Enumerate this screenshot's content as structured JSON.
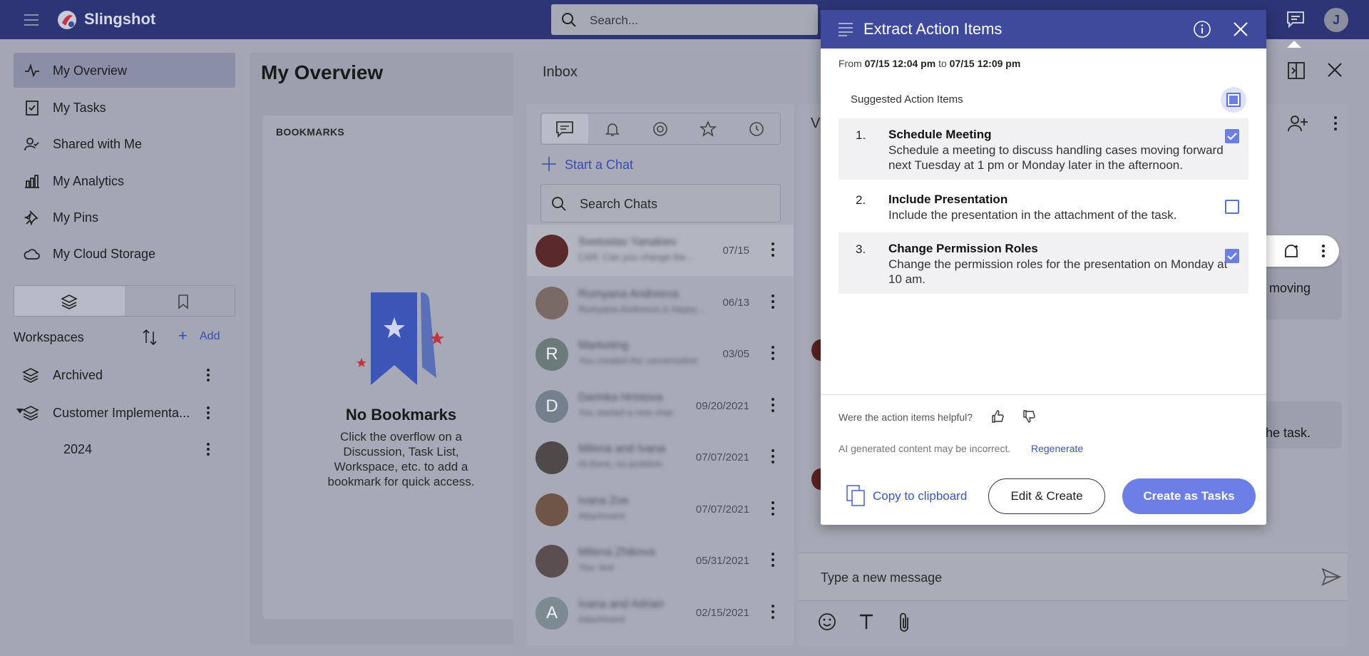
{
  "app": {
    "brand": "Slingshot",
    "user_initial": "J"
  },
  "search": {
    "placeholder": "Search..."
  },
  "nav": {
    "items": [
      {
        "label": "My Overview",
        "icon": "activity-icon"
      },
      {
        "label": "My Tasks",
        "icon": "task-icon"
      },
      {
        "label": "Shared with Me",
        "icon": "user-check-icon"
      },
      {
        "label": "My Analytics",
        "icon": "bar-chart-icon"
      },
      {
        "label": "My Pins",
        "icon": "pin-icon"
      },
      {
        "label": "My Cloud Storage",
        "icon": "cloud-icon"
      }
    ]
  },
  "workspaces": {
    "title": "Workspaces",
    "add_label": "Add",
    "items": [
      {
        "label": "Archived"
      },
      {
        "label": "Customer Implementa..."
      },
      {
        "label": "2024"
      }
    ]
  },
  "main": {
    "title": "My Overview",
    "bookmarks": {
      "header": "BOOKMARKS",
      "empty_title": "No Bookmarks",
      "empty_desc": "Click the overflow on a Discussion, Task List, Workspace, etc. to add a bookmark for quick access."
    }
  },
  "inbox": {
    "title": "Inbox",
    "start_chat": "Start a Chat",
    "search_placeholder": "Search Chats",
    "chats": [
      {
        "name": "Svetoslav Yanakiev",
        "preview": "CAR: Can you change the...",
        "date": "07/15",
        "initial": "",
        "color": "#5a2a2a"
      },
      {
        "name": "Rumyana Andreeva",
        "preview": "Rumyana Andreeva is happy...",
        "date": "06/13",
        "initial": "",
        "color": "#7a6a66"
      },
      {
        "name": "Marketing",
        "preview": "You created the conversation",
        "date": "03/05",
        "initial": "R",
        "color": "#6d7a7a"
      },
      {
        "name": "Darinka Hristova",
        "preview": "You started a new chat",
        "date": "09/20/2021",
        "initial": "D",
        "color": "#74808e"
      },
      {
        "name": "Milena and Ivana",
        "preview": "Hi there, no problem",
        "date": "07/07/2021",
        "initial": "",
        "color": "#4e4a4a"
      },
      {
        "name": "Ivana Zoe",
        "preview": "Attachment",
        "date": "07/07/2021",
        "initial": "",
        "color": "#6e5548"
      },
      {
        "name": "Milena Zhikova",
        "preview": "You: test",
        "date": "05/31/2021",
        "initial": "",
        "color": "#5a4e50"
      },
      {
        "name": "Ivana and Adrian",
        "preview": "Attachment",
        "date": "02/15/2021",
        "initial": "A",
        "color": "#7c8a92"
      }
    ],
    "conversation": {
      "title_initial": "V",
      "bubble1": "s moving",
      "bubble2": "of the task.",
      "input_placeholder": "Type a new message"
    }
  },
  "modal": {
    "title": "Extract Action Items",
    "range_from_label": "From",
    "range_from": "07/15 12:04 pm",
    "range_to_label": "to",
    "range_to": "07/15 12:09 pm",
    "suggested_label": "Suggested Action Items",
    "items": [
      {
        "num": "1.",
        "title": "Schedule Meeting",
        "desc": "Schedule a meeting to discuss handling cases moving forward next Tuesday at 1 pm or Monday later in the afternoon.",
        "checked": true
      },
      {
        "num": "2.",
        "title": "Include Presentation",
        "desc": "Include the presentation in the attachment of the task.",
        "checked": false
      },
      {
        "num": "3.",
        "title": "Change Permission Roles",
        "desc": "Change the permission roles for the presentation on Monday at 10 am.",
        "checked": true
      }
    ],
    "helpful_label": "Were the action items helpful?",
    "disclaimer": "AI generated content may be incorrect.",
    "regenerate": "Regenerate",
    "copy_label": "Copy to clipboard",
    "edit_label": "Edit & Create",
    "create_label": "Create as Tasks"
  },
  "colors": {
    "topbar": "#2d3577",
    "modal_header": "#3e4a9c",
    "accent": "#6b7fe6",
    "link": "#3a55c8"
  }
}
